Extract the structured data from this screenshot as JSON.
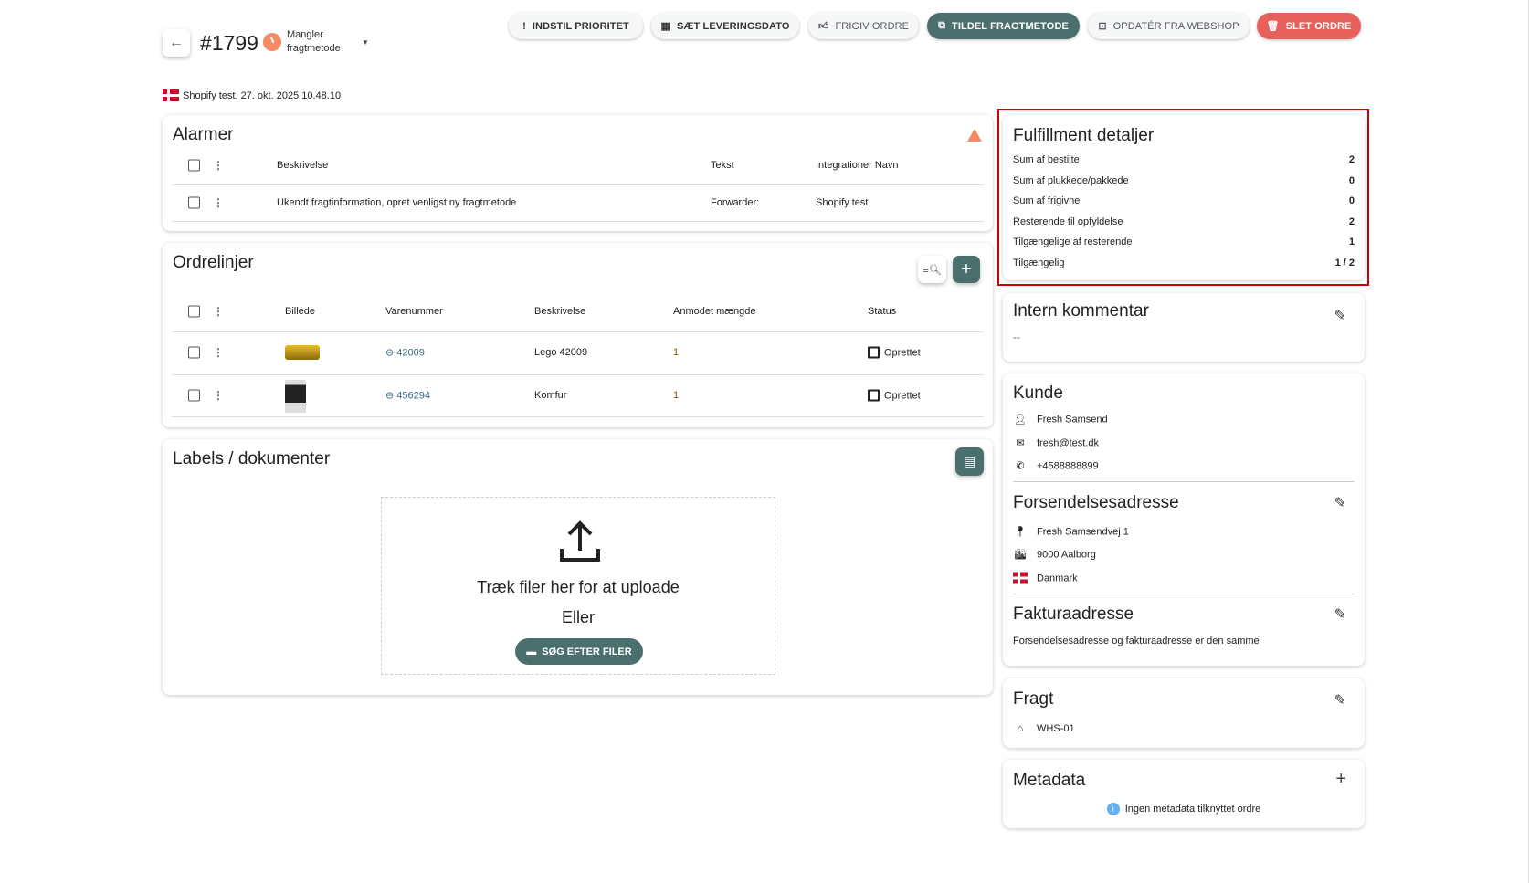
{
  "header": {
    "order_number": "#1799",
    "status": "Mangler fragtmetode",
    "source_line": "Shopify test, 27. okt. 2025 10.48.10"
  },
  "toolbar": {
    "set_priority": "INDSTIL PRIORITET",
    "set_delivery_date": "SÆT LEVERINGSDATO",
    "release_order": "FRIGIV ORDRE",
    "assign_shipping": "TILDEL FRAGTMETODE",
    "update_from_webshop": "OPDATÉR FRA WEBSHOP",
    "delete_order": "SLET ORDRE"
  },
  "alarms": {
    "title": "Alarmer",
    "columns": [
      "Beskrivelse",
      "Tekst",
      "Integrationer Navn"
    ],
    "rows": [
      {
        "description": "Ukendt fragtinformation, opret venligst ny fragtmetode",
        "text": "Forwarder:",
        "integration": "Shopify test"
      }
    ]
  },
  "order_lines": {
    "title": "Ordrelinjer",
    "columns": [
      "Billede",
      "Varenummer",
      "Beskrivelse",
      "Anmodet mængde",
      "Status"
    ],
    "rows": [
      {
        "sku": "42009",
        "description": "Lego 42009",
        "qty": "1",
        "status": "Oprettet"
      },
      {
        "sku": "456294",
        "description": "Komfur",
        "qty": "1",
        "status": "Oprettet"
      }
    ]
  },
  "labels": {
    "title": "Labels / dokumenter",
    "drop_text": "Træk filer her for at uploade",
    "or": "Eller",
    "browse": "SØG EFTER FILER"
  },
  "fulfillment": {
    "title": "Fulfillment detaljer",
    "rows": [
      {
        "label": "Sum af bestilte",
        "value": "2"
      },
      {
        "label": "Sum af plukkede/pakkede",
        "value": "0"
      },
      {
        "label": "Sum af frigivne",
        "value": "0"
      },
      {
        "label": "Resterende til opfyldelse",
        "value": "2"
      },
      {
        "label": "Tilgængelige af resterende",
        "value": "1"
      },
      {
        "label": "Tilgængelig",
        "value": "1 / 2"
      }
    ]
  },
  "comment": {
    "title": "Intern kommentar",
    "value": "--"
  },
  "customer": {
    "title": "Kunde",
    "name": "Fresh Samsend",
    "email": "fresh@test.dk",
    "phone": "+4588888899"
  },
  "shipping_address": {
    "title": "Forsendelsesadresse",
    "street": "Fresh Samsendvej 1",
    "city": "9000 Aalborg",
    "country": "Danmark"
  },
  "billing_address": {
    "title": "Fakturaadresse",
    "note": "Forsendelsesadresse og fakturaadresse er den samme"
  },
  "freight": {
    "title": "Fragt",
    "warehouse": "WHS-01"
  },
  "metadata": {
    "title": "Metadata",
    "empty": "Ingen metadata tilknyttet ordre"
  },
  "colors": {
    "accent": "#4a6f6d",
    "danger": "#e8605b",
    "warning": "#f58a64",
    "highlight": "#cc0000"
  }
}
